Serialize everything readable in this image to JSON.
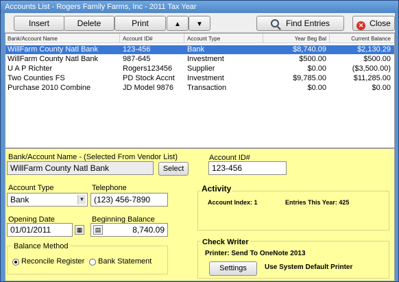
{
  "window": {
    "title": "Accounts List - Rogers Family Farms, Inc - 2011 Tax Year"
  },
  "toolbar": {
    "insert": "Insert",
    "delete": "Delete",
    "print": "Print",
    "up": "▲",
    "down": "▼",
    "find": "Find Entries",
    "close": "Close"
  },
  "list": {
    "headers": [
      "Bank/Account Name",
      "Account ID#",
      "Account Type",
      "Year Beg Bal",
      "Current Balance"
    ],
    "rows": [
      {
        "name": "WillFarm County Natl Bank",
        "id": "123-456",
        "type": "Bank",
        "beg": "$8,740.09",
        "cur": "$2,130.29",
        "selected": true
      },
      {
        "name": "WillFarm County Natl Bank",
        "id": "987-645",
        "type": "Investment",
        "beg": "$500.00",
        "cur": "$500.00"
      },
      {
        "name": "U A P Richter",
        "id": "Rogers123456",
        "type": "Supplier",
        "beg": "$0.00",
        "cur": "($3,500.00)"
      },
      {
        "name": "Two Counties FS",
        "id": "PD Stock Accnt",
        "type": "Investment",
        "beg": "$9,785.00",
        "cur": "$11,285.00"
      },
      {
        "name": "Purchase 2010 Combine",
        "id": "JD Model 9876",
        "type": "Transaction",
        "beg": "$0.00",
        "cur": "$0.00"
      }
    ]
  },
  "form": {
    "name_label": "Bank/Account Name  -  (Selected From Vendor List)",
    "name_value": "WillFarm County Natl Bank",
    "select_button": "Select",
    "account_id_label": "Account ID#",
    "account_id_value": "123-456",
    "account_type_label": "Account Type",
    "account_type_value": "Bank",
    "telephone_label": "Telephone",
    "telephone_value": "(123) 456-7890",
    "opening_date_label": "Opening Date",
    "opening_date_value": "01/01/2011",
    "beginning_balance_label": "Beginning Balance",
    "beginning_balance_value": "8,740.09",
    "balance_method_label": "Balance Method",
    "reconcile_label": "Reconcile Register",
    "bank_statement_label": "Bank Statement",
    "reconcile_selected": true
  },
  "activity": {
    "title": "Activity",
    "account_index": "Account Index: 1",
    "entries_this_year": "Entries This Year: 425"
  },
  "check_writer": {
    "title": "Check Writer",
    "printer": "Printer: Send To OneNote 2013",
    "settings_button": "Settings",
    "default_printer": "Use System Default Printer"
  },
  "colors": {
    "panel": "#ffff9e",
    "selection": "#3b78d6",
    "close_icon": "#d8302a"
  },
  "icons": {
    "find": "magnifier-icon",
    "close": "close-circle-icon",
    "calendar": "calendar-icon",
    "calculator": "calculator-icon"
  }
}
